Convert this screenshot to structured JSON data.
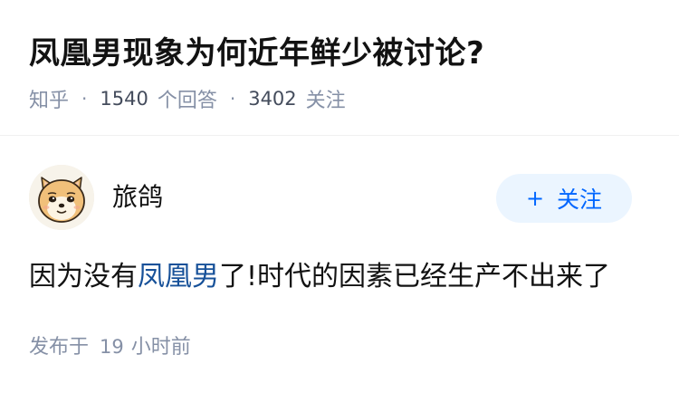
{
  "question": {
    "title": "凤凰男现象为何近年鲜少被讨论?",
    "source": "知乎",
    "separator": "·",
    "answer_count": "1540",
    "answer_label": "个回答",
    "follow_count": "3402",
    "follow_label": "关注"
  },
  "answer": {
    "author": {
      "name": "旅鸽",
      "avatar_icon": "shiba-dog-avatar-icon"
    },
    "follow_button": {
      "plus": "+",
      "label": "关注"
    },
    "content": {
      "before": "因为没有",
      "link": "凤凰男",
      "after": "了!时代的因素已经生产不出来了"
    },
    "publish": {
      "prefix": "发布于",
      "number": "19",
      "suffix": "小时前"
    }
  },
  "colors": {
    "title": "#121212",
    "meta": "#8590a6",
    "link": "#175199",
    "follow_button_bg": "#ebf5ff",
    "follow_button_text": "#0066ff"
  }
}
